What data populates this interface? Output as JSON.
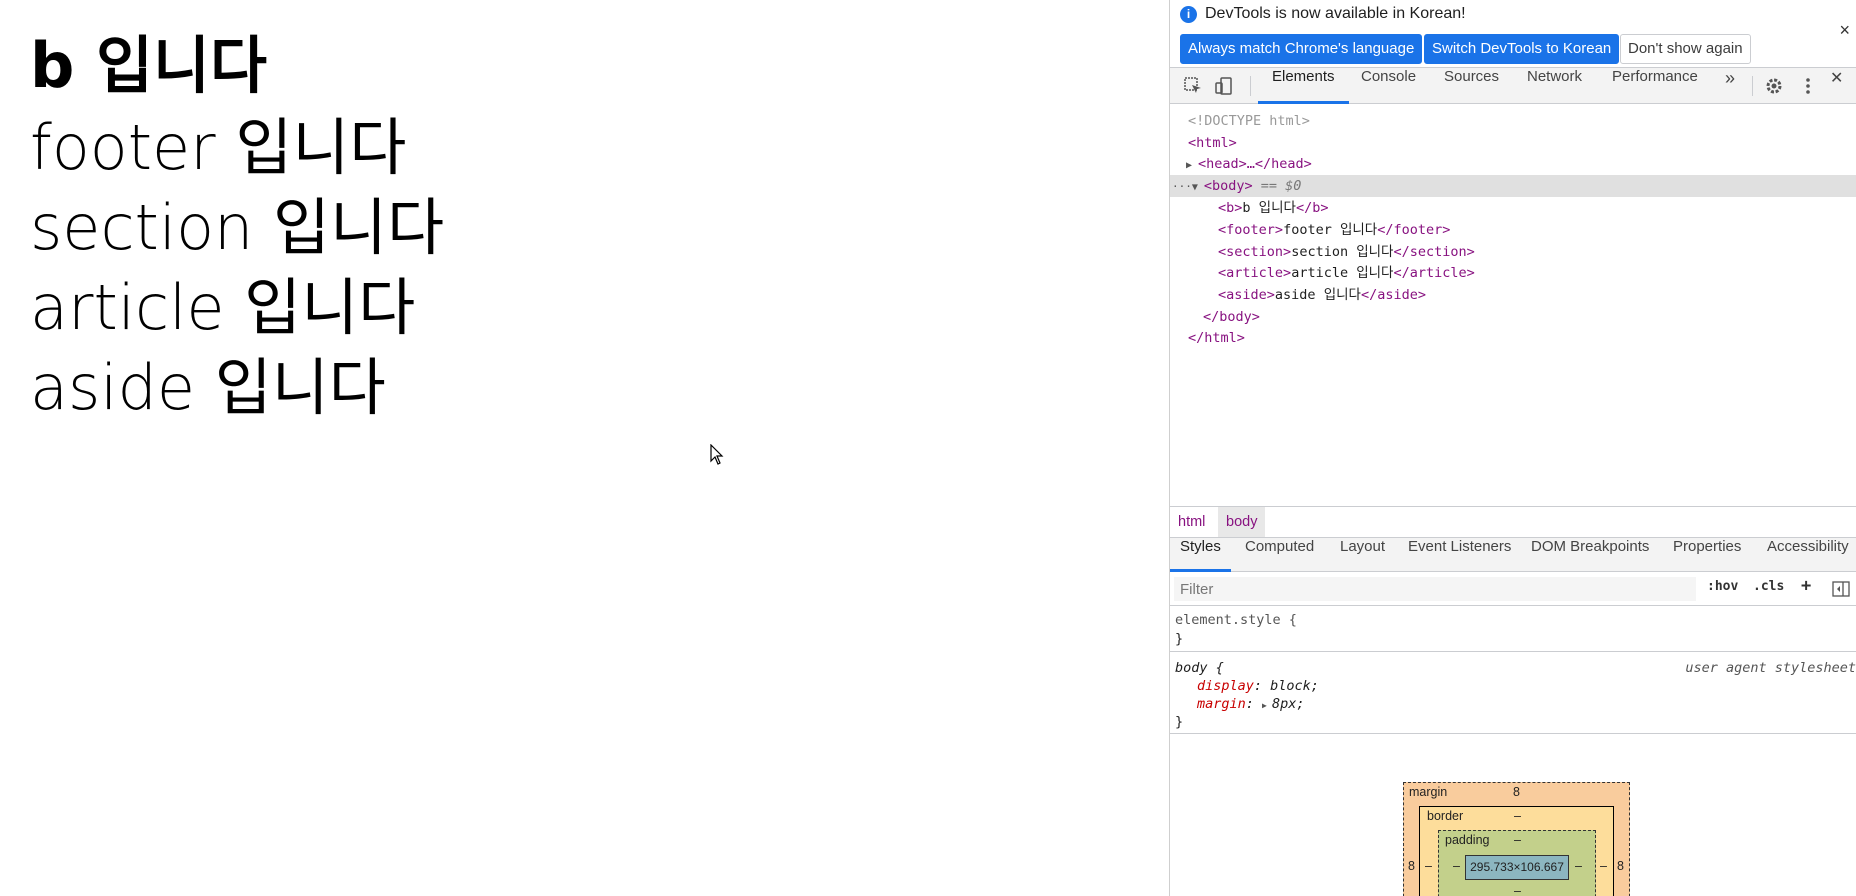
{
  "page": {
    "lines": [
      {
        "text": "b 입니다",
        "bold": true
      },
      {
        "text": "footer 입니다",
        "bold": false
      },
      {
        "text": "section 입니다",
        "bold": false
      },
      {
        "text": "article 입니다",
        "bold": false
      },
      {
        "text": "aside 입니다",
        "bold": false
      }
    ]
  },
  "infobar": {
    "message": "DevTools is now available in Korean!",
    "btn_match": "Always match Chrome's language",
    "btn_switch": "Switch DevTools to Korean",
    "btn_dismiss": "Don't show again",
    "close": "×"
  },
  "main_tabs": {
    "elements": "Elements",
    "console": "Console",
    "sources": "Sources",
    "network": "Network",
    "performance": "Performance",
    "more": "»",
    "close": "✕"
  },
  "dom": {
    "doctype": "<!DOCTYPE html>",
    "html_open": "<html>",
    "head": "<head>…</head>",
    "body_open": "<body>",
    "body_marker": "== $0",
    "children": [
      {
        "tag": "b",
        "text": "b 입니다"
      },
      {
        "tag": "footer",
        "text": "footer 입니다"
      },
      {
        "tag": "section",
        "text": "section 입니다"
      },
      {
        "tag": "article",
        "text": "article 입니다"
      },
      {
        "tag": "aside",
        "text": "aside 입니다"
      }
    ],
    "body_close": "</body>",
    "html_close": "</html>"
  },
  "breadcrumbs": {
    "html": "html",
    "body": "body"
  },
  "sub_tabs": {
    "styles": "Styles",
    "computed": "Computed",
    "layout": "Layout",
    "event_listeners": "Event Listeners",
    "dom_breakpoints": "DOM Breakpoints",
    "properties": "Properties",
    "accessibility": "Accessibility"
  },
  "filter": {
    "placeholder": "Filter",
    "hov": ":hov",
    "cls": ".cls",
    "plus": "+"
  },
  "styles": {
    "element_style": "element.style {",
    "close_brace": "}",
    "body_selector": "body {",
    "ua": "user agent stylesheet",
    "display_prop": "display",
    "display_val": "block;",
    "margin_prop": "margin",
    "margin_val": "8px;"
  },
  "box_model": {
    "margin_label": "margin",
    "margin_top": "8",
    "margin_left": "8",
    "margin_right": "8",
    "border_label": "border",
    "border_top": "–",
    "padding_label": "padding",
    "padding_top": "–",
    "content": "295.733×106.667",
    "dash": "–"
  }
}
